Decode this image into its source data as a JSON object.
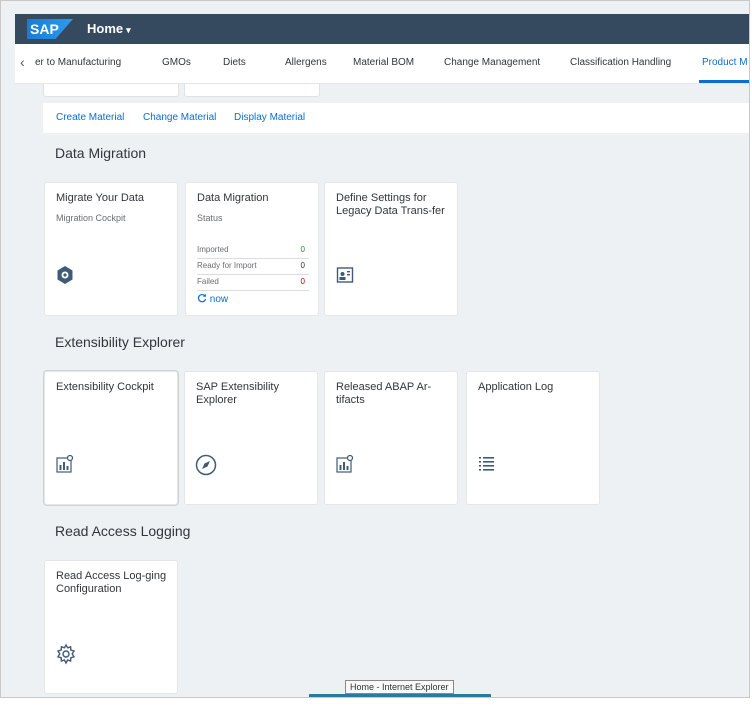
{
  "shell": {
    "logo": "SAP",
    "home_label": "Home",
    "caret": "▾"
  },
  "tabs": {
    "back": "‹",
    "items": [
      "er to Manufacturing",
      "GMOs",
      "Diets",
      "Allergens",
      "Material BOM",
      "Change Management",
      "Classification Handling",
      "Product M"
    ],
    "active_index": 7
  },
  "links": [
    "Create Material",
    "Change Material",
    "Display Material"
  ],
  "sections": {
    "data_migration": {
      "title": "Data Migration",
      "tiles": [
        {
          "title": "Migrate Your Data",
          "subtitle": "Migration Cockpit",
          "icon": "migration-icon"
        },
        {
          "title": "Data Migration",
          "subtitle": "Status",
          "rows": [
            {
              "label": "Imported",
              "value": "0",
              "color": "#2b7d2b"
            },
            {
              "label": "Ready for Import",
              "value": "0",
              "color": "#32363a"
            },
            {
              "label": "Failed",
              "value": "0",
              "color": "#bb0000"
            }
          ],
          "refresh": "now"
        },
        {
          "title": "Define Settings for Legacy Data Trans-fer",
          "icon": "contact-card-icon"
        }
      ]
    },
    "extensibility": {
      "title": "Extensibility Explorer",
      "tiles": [
        {
          "title": "Extensibility Cockpit",
          "icon": "bar-chart-search-icon"
        },
        {
          "title": "SAP Extensibility Explorer",
          "icon": "compass-icon"
        },
        {
          "title": "Released ABAP Ar-tifacts",
          "icon": "bar-chart-search-icon"
        },
        {
          "title": "Application Log",
          "icon": "list-icon"
        }
      ]
    },
    "read_access": {
      "title": "Read Access Logging",
      "tiles": [
        {
          "title": "Read Access Log-ging Configuration",
          "icon": "gear-icon"
        }
      ]
    }
  },
  "tooltip": "Home - Internet Explorer"
}
